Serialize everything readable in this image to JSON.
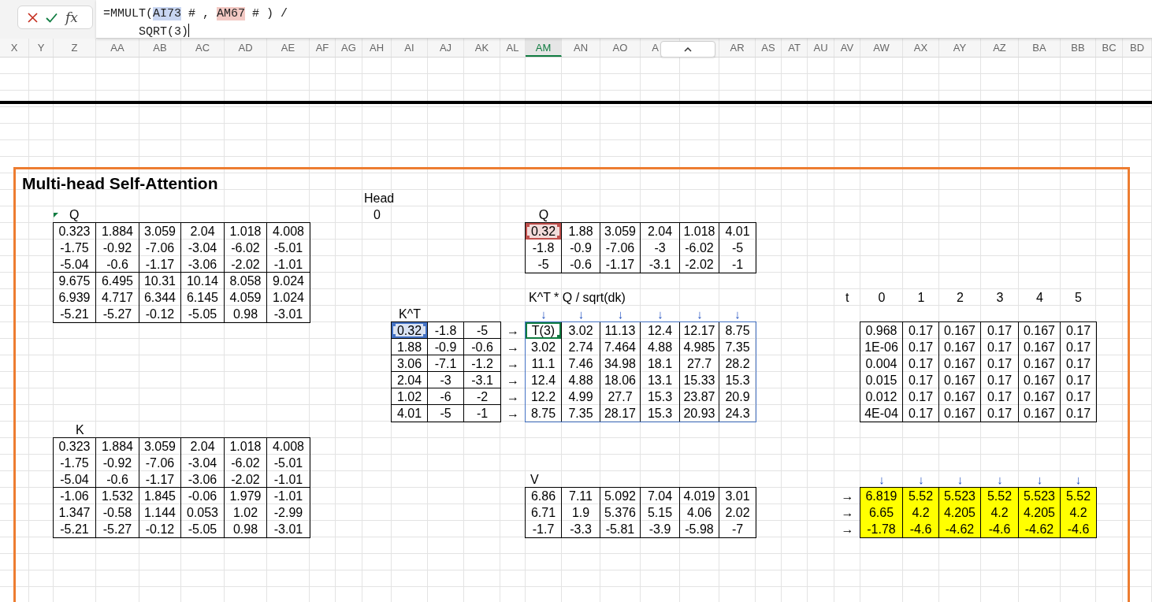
{
  "formula_bar": {
    "function_label": "fx",
    "line_1": [
      {
        "text": "=MMULT(",
        "kind": "plain"
      },
      {
        "text": "AI73",
        "kind": "reference",
        "color": "#c9d6f2"
      },
      {
        "text": " # , ",
        "kind": "plain"
      },
      {
        "text": "AM67",
        "kind": "reference",
        "color": "#f3c9c4"
      },
      {
        "text": " # ) /",
        "kind": "plain"
      }
    ],
    "line_2": "SQRT(3)"
  },
  "columns": [
    {
      "label": "X",
      "selected": false
    },
    {
      "label": "Y",
      "selected": false
    },
    {
      "label": "Z",
      "selected": false
    },
    {
      "label": "AA",
      "selected": false
    },
    {
      "label": "AB",
      "selected": false
    },
    {
      "label": "AC",
      "selected": false
    },
    {
      "label": "AD",
      "selected": false
    },
    {
      "label": "AE",
      "selected": false
    },
    {
      "label": "AF",
      "selected": false
    },
    {
      "label": "AG",
      "selected": false
    },
    {
      "label": "AH",
      "selected": false
    },
    {
      "label": "AI",
      "selected": false
    },
    {
      "label": "AJ",
      "selected": false
    },
    {
      "label": "AK",
      "selected": false
    },
    {
      "label": "AL",
      "selected": false
    },
    {
      "label": "AM",
      "selected": true
    },
    {
      "label": "AN",
      "selected": false
    },
    {
      "label": "AO",
      "selected": false
    },
    {
      "label": "A",
      "selected": false
    },
    {
      "label": "AR",
      "selected": false
    },
    {
      "label": "AS",
      "selected": false
    },
    {
      "label": "AT",
      "selected": false
    },
    {
      "label": "AU",
      "selected": false
    },
    {
      "label": "AV",
      "selected": false
    },
    {
      "label": "AW",
      "selected": false
    },
    {
      "label": "AX",
      "selected": false
    },
    {
      "label": "AY",
      "selected": false
    },
    {
      "label": "AZ",
      "selected": false
    },
    {
      "label": "BA",
      "selected": false
    },
    {
      "label": "BB",
      "selected": false
    },
    {
      "label": "BC",
      "selected": false
    },
    {
      "label": "BD",
      "selected": false
    }
  ],
  "sheet": {
    "title": "Multi-head Self-Attention",
    "head_label": "Head",
    "head_value": "0",
    "matrices": [
      {
        "label": "Q",
        "kind": "split",
        "rows": [
          [
            "0.323",
            "1.884",
            "3.059",
            "2.04",
            "1.018",
            "4.008"
          ],
          [
            "-1.75",
            "-0.92",
            "-7.06",
            "-3.04",
            "-6.02",
            "-5.01"
          ],
          [
            "-5.04",
            "-0.6",
            "-1.17",
            "-3.06",
            "-2.02",
            "-1.01"
          ],
          [
            "9.675",
            "6.495",
            "10.31",
            "10.14",
            "8.058",
            "9.024"
          ],
          [
            "6.939",
            "4.717",
            "6.344",
            "6.145",
            "4.059",
            "1.024"
          ],
          [
            "-5.21",
            "-5.27",
            "-0.12",
            "-5.05",
            "0.98",
            "-3.01"
          ]
        ]
      },
      {
        "label": "K^T",
        "kind": "ruled",
        "first_cell": {
          "kind": "reference",
          "color": "#4472c4"
        },
        "rows": [
          [
            "0.32",
            "-1.8",
            "-5"
          ],
          [
            "1.88",
            "-0.9",
            "-0.6"
          ],
          [
            "3.06",
            "-7.1",
            "-1.2"
          ],
          [
            "2.04",
            "-3",
            "-3.1"
          ],
          [
            "1.02",
            "-6",
            "-2"
          ],
          [
            "4.01",
            "-5",
            "-1"
          ]
        ]
      },
      {
        "label": "Q",
        "kind": "columns",
        "first_cell": {
          "kind": "reference",
          "color": "#c0504d"
        },
        "rows": [
          [
            "0.32",
            "1.88",
            "3.059",
            "2.04",
            "1.018",
            "4.01"
          ],
          [
            "-1.8",
            "-0.9",
            "-7.06",
            "-3",
            "-6.02",
            "-5"
          ],
          [
            "-5",
            "-0.6",
            "-1.17",
            "-3.1",
            "-2.02",
            "-1"
          ]
        ]
      },
      {
        "label": "K^T * Q / sqrt(dk)",
        "kind": "range",
        "first_cell": {
          "kind": "active",
          "color": "#107c41"
        },
        "top_arrows": [
          "↓",
          "↓",
          "↓",
          "↓",
          "↓",
          "↓"
        ],
        "left_arrows": [
          "→",
          "→",
          "→",
          "→",
          "→",
          "→"
        ],
        "rows": [
          [
            "T(3)",
            "3.02",
            "11.13",
            "12.4",
            "12.17",
            "8.75"
          ],
          [
            "3.02",
            "2.74",
            "7.464",
            "4.88",
            "4.985",
            "7.35"
          ],
          [
            "11.1",
            "7.46",
            "34.98",
            "18.1",
            "27.7",
            "28.2"
          ],
          [
            "12.4",
            "4.88",
            "18.06",
            "13.1",
            "15.33",
            "15.3"
          ],
          [
            "12.2",
            "4.99",
            "27.7",
            "15.3",
            "23.87",
            "20.9"
          ],
          [
            "8.75",
            "7.35",
            "28.17",
            "15.3",
            "20.93",
            "24.3"
          ]
        ]
      },
      {
        "kind": "columns",
        "header_label": "t",
        "column_labels": [
          "0",
          "1",
          "2",
          "3",
          "4",
          "5"
        ],
        "rows": [
          [
            "0.968",
            "0.17",
            "0.167",
            "0.17",
            "0.167",
            "0.17"
          ],
          [
            "1E-06",
            "0.17",
            "0.167",
            "0.17",
            "0.167",
            "0.17"
          ],
          [
            "0.004",
            "0.17",
            "0.167",
            "0.17",
            "0.167",
            "0.17"
          ],
          [
            "0.015",
            "0.17",
            "0.167",
            "0.17",
            "0.167",
            "0.17"
          ],
          [
            "0.012",
            "0.17",
            "0.167",
            "0.17",
            "0.167",
            "0.17"
          ],
          [
            "4E-04",
            "0.17",
            "0.167",
            "0.17",
            "0.167",
            "0.17"
          ]
        ]
      },
      {
        "label": "K",
        "kind": "split",
        "rows": [
          [
            "0.323",
            "1.884",
            "3.059",
            "2.04",
            "1.018",
            "4.008"
          ],
          [
            "-1.75",
            "-0.92",
            "-7.06",
            "-3.04",
            "-6.02",
            "-5.01"
          ],
          [
            "-5.04",
            "-0.6",
            "-1.17",
            "-3.06",
            "-2.02",
            "-1.01"
          ],
          [
            "-1.06",
            "1.532",
            "1.845",
            "-0.06",
            "1.979",
            "-1.01"
          ],
          [
            "1.347",
            "-0.58",
            "1.144",
            "0.053",
            "1.02",
            "-2.99"
          ],
          [
            "-5.21",
            "-5.27",
            "-0.12",
            "-5.05",
            "0.98",
            "-3.01"
          ]
        ]
      },
      {
        "label": "V",
        "kind": "columns",
        "rows": [
          [
            "6.86",
            "7.11",
            "5.092",
            "7.04",
            "4.019",
            "3.01"
          ],
          [
            "6.71",
            "1.9",
            "5.376",
            "5.15",
            "4.06",
            "2.02"
          ],
          [
            "-1.7",
            "-3.3",
            "-5.81",
            "-3.9",
            "-5.98",
            "-7"
          ]
        ]
      },
      {
        "kind": "columns",
        "color": "#ffff00",
        "top_arrows": [
          "↓",
          "↓",
          "↓",
          "↓",
          "↓",
          "↓"
        ],
        "left_arrows": [
          "→",
          "→",
          "→"
        ],
        "rows": [
          [
            "6.819",
            "5.52",
            "5.523",
            "5.52",
            "5.523",
            "5.52"
          ],
          [
            "6.65",
            "4.2",
            "4.205",
            "4.2",
            "4.205",
            "4.2"
          ],
          [
            "-1.78",
            "-4.6",
            "-4.62",
            "-4.6",
            "-4.62",
            "-4.6"
          ]
        ]
      }
    ]
  }
}
